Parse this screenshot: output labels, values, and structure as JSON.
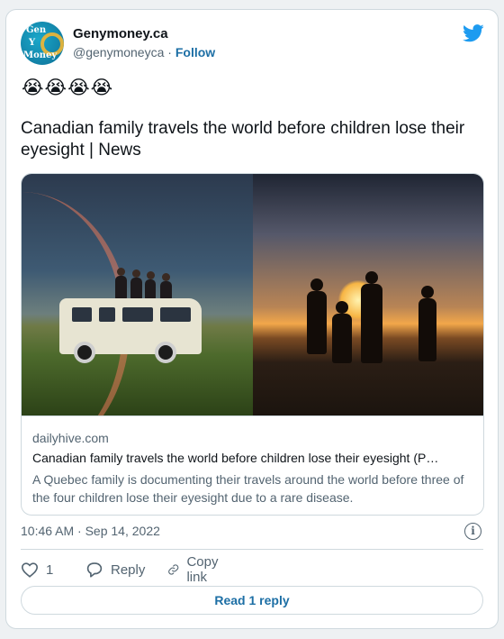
{
  "author": {
    "name": "Genymoney.ca",
    "handle": "@genymoneyca",
    "separator": "·",
    "follow_label": "Follow",
    "avatar_text": [
      "Gen",
      "Y",
      "Money"
    ]
  },
  "tweet": {
    "emojis": "😭😭😭😭",
    "text": "Canadian family travels the world before children lose their eyesight | News"
  },
  "link_card": {
    "domain": "dailyhive.com",
    "title": "Canadian family travels the world before children lose their eyesight (P…",
    "description": "A Quebec family is documenting their travels around the world before three of the four children lose their eyesight due to a rare disease."
  },
  "meta": {
    "timestamp": "10:46 AM · Sep 14, 2022"
  },
  "actions": {
    "like_count": "1",
    "reply_label": "Reply",
    "copy_link_label": "Copy link"
  },
  "read_reply_label": "Read 1 reply",
  "icons": {
    "platform": "twitter-bird-icon",
    "info": "info-icon",
    "like": "heart-icon",
    "reply": "speech-bubble-icon",
    "copy": "link-icon"
  },
  "colors": {
    "brand": "#1d9bf0",
    "link": "#1d6fa5",
    "muted": "#536471",
    "border": "#cfd9de"
  }
}
